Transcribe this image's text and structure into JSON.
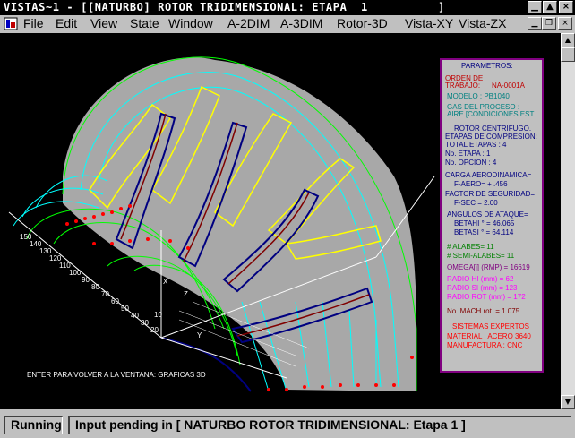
{
  "window": {
    "title": "VISTAS~1 - [[NATURBO] ROTOR TRIDIMENSIONAL: ETAPA  1          ]",
    "min_icon": "minimize-icon",
    "max_icon": "maximize-icon",
    "close_icon": "close-icon"
  },
  "menu": [
    "File",
    "Edit",
    "View",
    "State",
    "Window",
    "A-2DIM",
    "A-3DIM",
    "Rotor-3D",
    "Vista-XY",
    "Vista-ZX"
  ],
  "params": {
    "heading": "PARAMETROS:",
    "orden_label": "ORDEN DE",
    "trabajo_label": "TRABAJO:",
    "trabajo_value": "NA-0001A",
    "modelo": "MODELO :  PB1040",
    "gas1": "GAS DEL PROCESO :",
    "gas2": "AIRE [CONDICIONES EST",
    "rotor": "ROTOR CENTRIFUGO.",
    "etapas": "ETAPAS DE COMPRESION:",
    "total": "TOTAL ETAPAS :     4",
    "etapa": "No. ETAPA :     1",
    "opcion": "No. OPCION :     4",
    "carga": "CARGA AERODINAMICA=",
    "faero": "F-AERO= + .456",
    "factor": "FACTOR DE SEGURIDAD=",
    "fsec": "F-SEC = 2.00",
    "angulos": "ANGULOS DE ATAQUE=",
    "betahi": "BETAHI ° =      46.065",
    "betasi": "BETASI ° =      64.114",
    "alabes": "# ALABES=             11",
    "semi": "# SEMI-ALABES=     11",
    "omega": "OMEGA[j] (RMP) = 16619",
    "radiohi": "RADIO HI (mm) =         62",
    "radiosi": "RADIO SI (mm) =       123",
    "radiorot": "RADIO ROT (mm) =     172",
    "mach": "No. MACH rot. =    1.075",
    "sistemas": "SISTEMAS EXPERTOS",
    "material": "MATERIAL : ACERO 3640",
    "manufactura": "MANUFACTURA :  CNC"
  },
  "axis": {
    "ticks": [
      "150",
      "140",
      "130",
      "120",
      "110",
      "100",
      "90",
      "80",
      "70",
      "60",
      "50",
      "40",
      "30",
      "20",
      "10"
    ],
    "x": "X",
    "y": "Y",
    "z": "Z"
  },
  "footer_message": "ENTER PARA VOLVER A LA VENTANA: GRAFICAS 3D",
  "status": {
    "state": "Running",
    "message": "Input pending in [ NATURBO ROTOR TRIDIMENSIONAL:  Etapa 1 ]"
  },
  "colors": {
    "canvas": "#000000",
    "hub": "#a8a8a8",
    "shroud_green": "#00ff00",
    "cyan": "#00ffff",
    "yellow": "#ffff00",
    "navy": "#000080",
    "red": "#ff0000",
    "panel_border": "#800080"
  }
}
